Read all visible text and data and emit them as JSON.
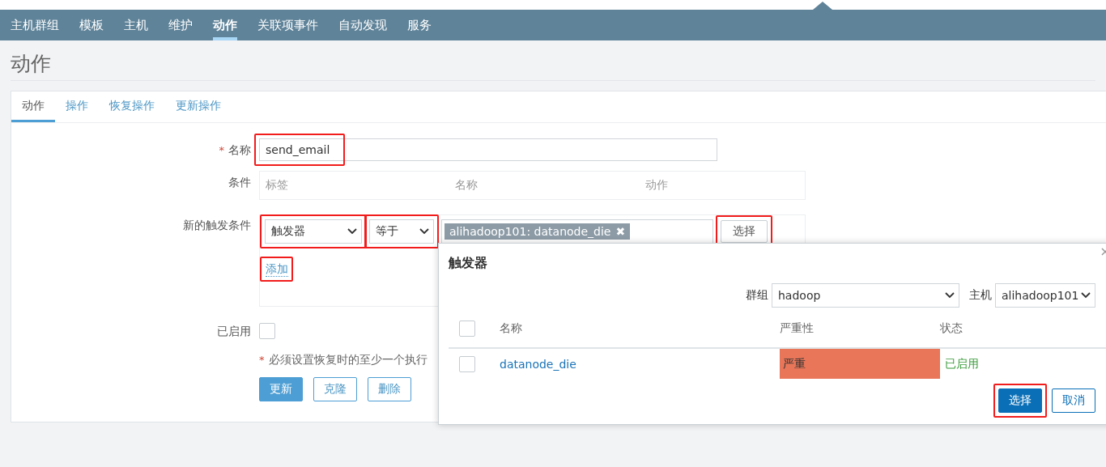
{
  "nav": [
    {
      "label": "主机群组",
      "selected": false
    },
    {
      "label": "模板",
      "selected": false
    },
    {
      "label": "主机",
      "selected": false
    },
    {
      "label": "维护",
      "selected": false
    },
    {
      "label": "动作",
      "selected": true
    },
    {
      "label": "关联项事件",
      "selected": false
    },
    {
      "label": "自动发现",
      "selected": false
    },
    {
      "label": "服务",
      "selected": false
    }
  ],
  "page_title": "动作",
  "tabs": [
    {
      "label": "动作",
      "selected": true
    },
    {
      "label": "操作",
      "selected": false
    },
    {
      "label": "恢复操作",
      "selected": false
    },
    {
      "label": "更新操作",
      "selected": false
    }
  ],
  "form": {
    "name": {
      "label": "名称",
      "required_mark": "*",
      "value": "send_email",
      "highlighted": true
    },
    "conditions": {
      "label": "条件",
      "columns": [
        "标签",
        "名称",
        "动作"
      ]
    },
    "new_condition": {
      "label": "新的触发条件",
      "type_select": {
        "value": "触发器",
        "highlighted": true
      },
      "operator_select": {
        "value": "等于",
        "highlighted": true
      },
      "tag": {
        "text": "alihadoop101: datanode_die",
        "remove": "✖"
      },
      "select_button": {
        "label": "选择",
        "highlighted": true
      },
      "add_link": {
        "label": "添加",
        "highlighted": true
      }
    },
    "enabled": {
      "label": "已启用",
      "checked": false
    },
    "note": {
      "mark": "*",
      "text": "必须设置恢复时的至少一个执行"
    },
    "buttons": [
      {
        "label": "更新",
        "primary": true
      },
      {
        "label": "克隆",
        "primary": false
      },
      {
        "label": "删除",
        "primary": false
      }
    ]
  },
  "dialog": {
    "title": "触发器",
    "all_checked": false,
    "group": {
      "label": "群组",
      "value": "hadoop"
    },
    "host": {
      "label": "主机",
      "value": "alihadoop101"
    },
    "columns": [
      "名称",
      "严重性",
      "状态"
    ],
    "rows": [
      {
        "name": "datanode_die",
        "severity": "严重",
        "color": "#e97659",
        "status": "已启用",
        "checked": false
      }
    ],
    "buttons": [
      {
        "label": "选择",
        "primary": true,
        "highlighted": true
      },
      {
        "label": "取消",
        "primary": false,
        "highlighted": false
      }
    ]
  }
}
